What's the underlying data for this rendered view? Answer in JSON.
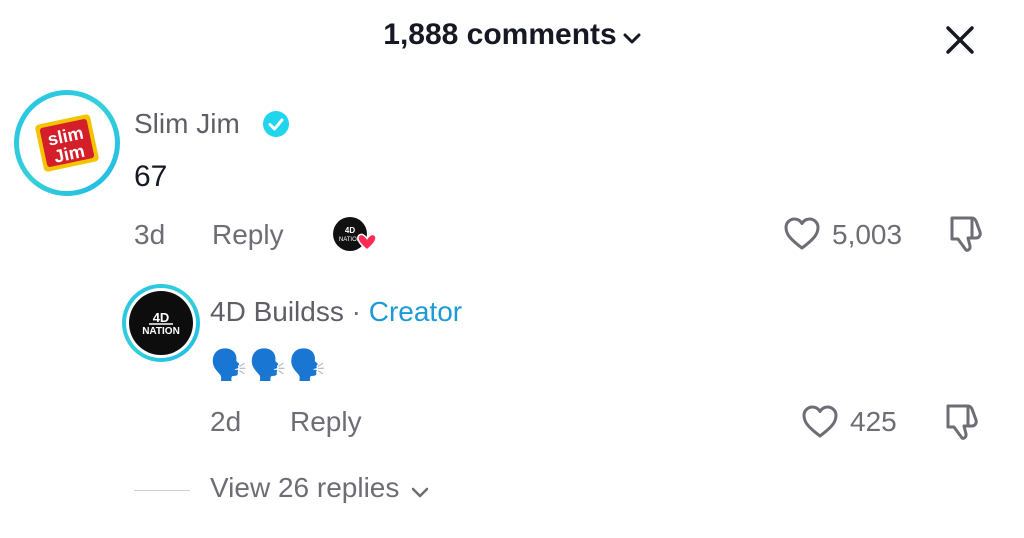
{
  "header": {
    "title": "1,888 comments"
  },
  "comments": [
    {
      "username": "Slim Jim",
      "verified": true,
      "text": "67",
      "age": "3d",
      "reply_label": "Reply",
      "likes": "5,003",
      "creator_liked": true,
      "avatar_logo": {
        "line1": "slim",
        "line2": "Jim"
      }
    }
  ],
  "reply": {
    "username": "4D Buildss",
    "separator": "·",
    "badge": "Creator",
    "text_emoji": "🗣️🗣️🗣️",
    "age": "2d",
    "reply_label": "Reply",
    "likes": "425",
    "avatar_logo": {
      "line1": "4D",
      "line2": "NATION"
    }
  },
  "view_replies": "View 26 replies",
  "colors": {
    "accent": "#1d9ad6",
    "ring": "#23c4e6",
    "heart": "#fe2c55"
  }
}
